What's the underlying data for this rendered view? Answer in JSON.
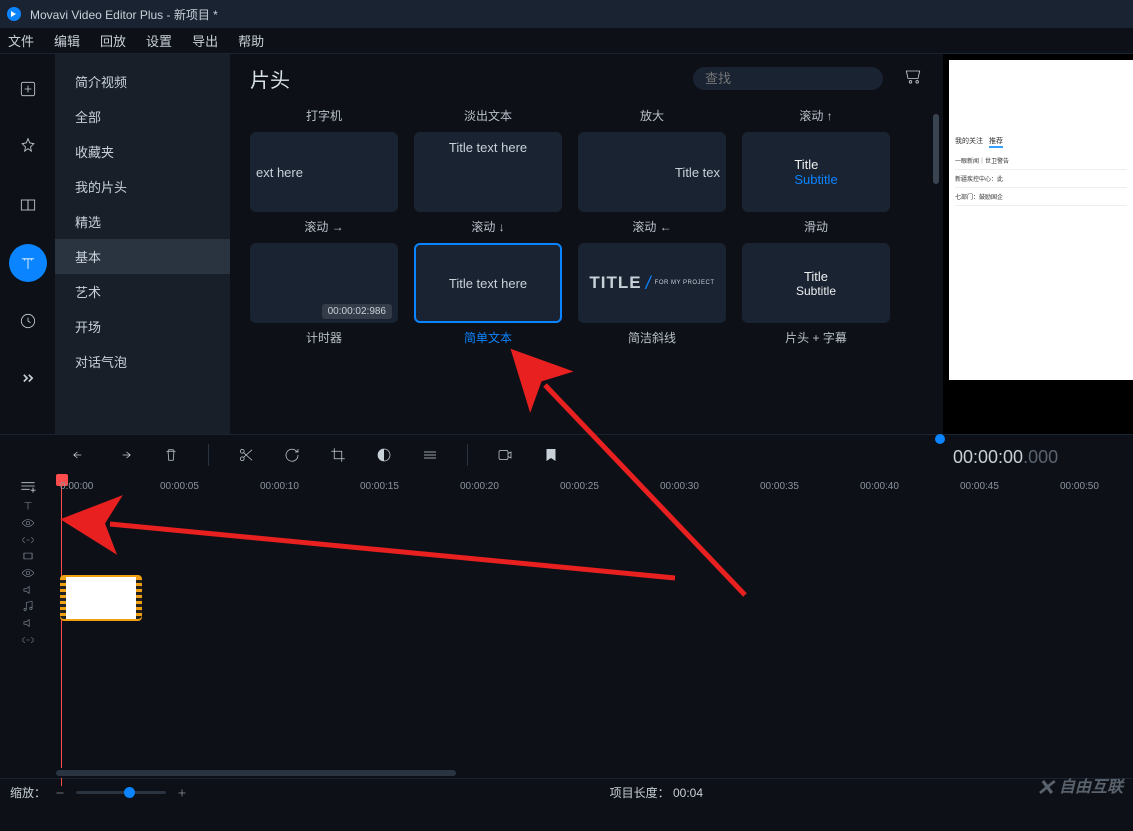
{
  "title_bar": "Movavi Video Editor Plus - 新项目 *",
  "menu": [
    "文件",
    "编辑",
    "回放",
    "设置",
    "导出",
    "帮助"
  ],
  "sidebar": {
    "categories": [
      "简介视频",
      "全部",
      "收藏夹",
      "我的片头",
      "精选",
      "基本",
      "艺术",
      "开场",
      "对话气泡"
    ],
    "active_index": 5
  },
  "gallery": {
    "heading": "片头",
    "search_placeholder": "查找",
    "row0": [
      {
        "thumb": "",
        "caption": "打字机"
      },
      {
        "thumb": "",
        "caption": "淡出文本"
      },
      {
        "thumb": "",
        "caption": "放大"
      },
      {
        "thumb": "",
        "caption": "滚动 ↑"
      }
    ],
    "row1": [
      {
        "thumb": "ext here",
        "caption": "滚动 →"
      },
      {
        "thumb": "Title text here",
        "caption": "滚动 ↓"
      },
      {
        "thumb": "Title tex",
        "caption": "滚动 ←"
      },
      {
        "thumb_title": "Title",
        "thumb_sub": "Subtitle",
        "caption": "滑动"
      }
    ],
    "row2": [
      {
        "thumb": "",
        "timestamp": "00:00:02:986",
        "caption": "计时器"
      },
      {
        "thumb": "Title text here",
        "caption": "简单文本",
        "selected": true
      },
      {
        "thumb_big": "TITLE",
        "thumb_small": "FOR MY PROJECT",
        "caption": "简洁斜线"
      },
      {
        "thumb_title": "Title",
        "thumb_sub2": "Subtitle",
        "caption": "片头 + 字幕"
      }
    ]
  },
  "preview": {
    "tabs": [
      "我的关注",
      "推荐"
    ],
    "lines": [
      "一眼新闻｜世卫警告",
      "新疆疾控中心：此",
      "七部门：鼓励国企"
    ],
    "time_main": "00:00:00",
    "time_ms": ".000"
  },
  "timeline": {
    "ticks": [
      "0:00:00",
      "00:00:05",
      "00:00:10",
      "00:00:15",
      "00:00:20",
      "00:00:25",
      "00:00:30",
      "00:00:35",
      "00:00:40",
      "00:00:45",
      "00:00:50"
    ]
  },
  "bottom": {
    "zoom_label": "缩放：",
    "project_len_label": "项目长度：",
    "project_len_value": "00:04"
  },
  "watermark": "自由互联"
}
